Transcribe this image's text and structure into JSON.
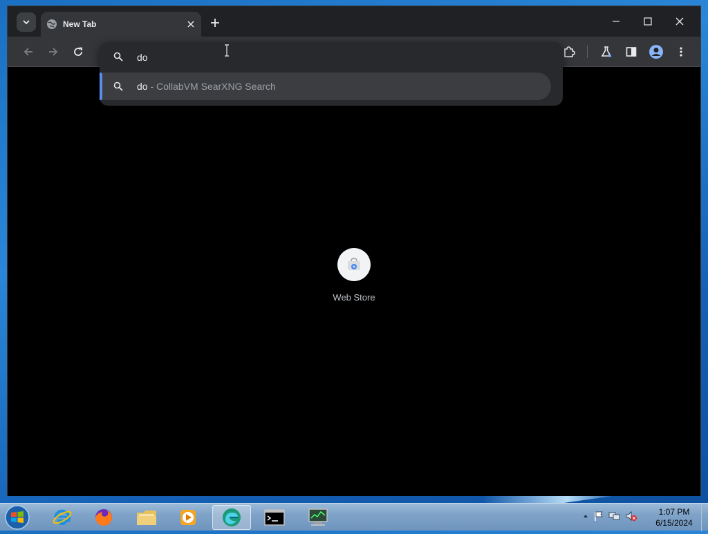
{
  "browser": {
    "tab": {
      "title": "New Tab"
    },
    "omnibox": {
      "input_value": "do",
      "suggestion": {
        "query": "do",
        "description": "- CollabVM SearXNG Search"
      }
    },
    "shortcuts": [
      {
        "label": "Web Store"
      }
    ]
  },
  "taskbar": {
    "clock": {
      "time": "1:07 PM",
      "date": "6/15/2024"
    }
  },
  "colors": {
    "accent": "#5b8def",
    "page_bg": "#000000",
    "toolbar_bg": "#35363a",
    "tabstrip_bg": "#202124"
  }
}
